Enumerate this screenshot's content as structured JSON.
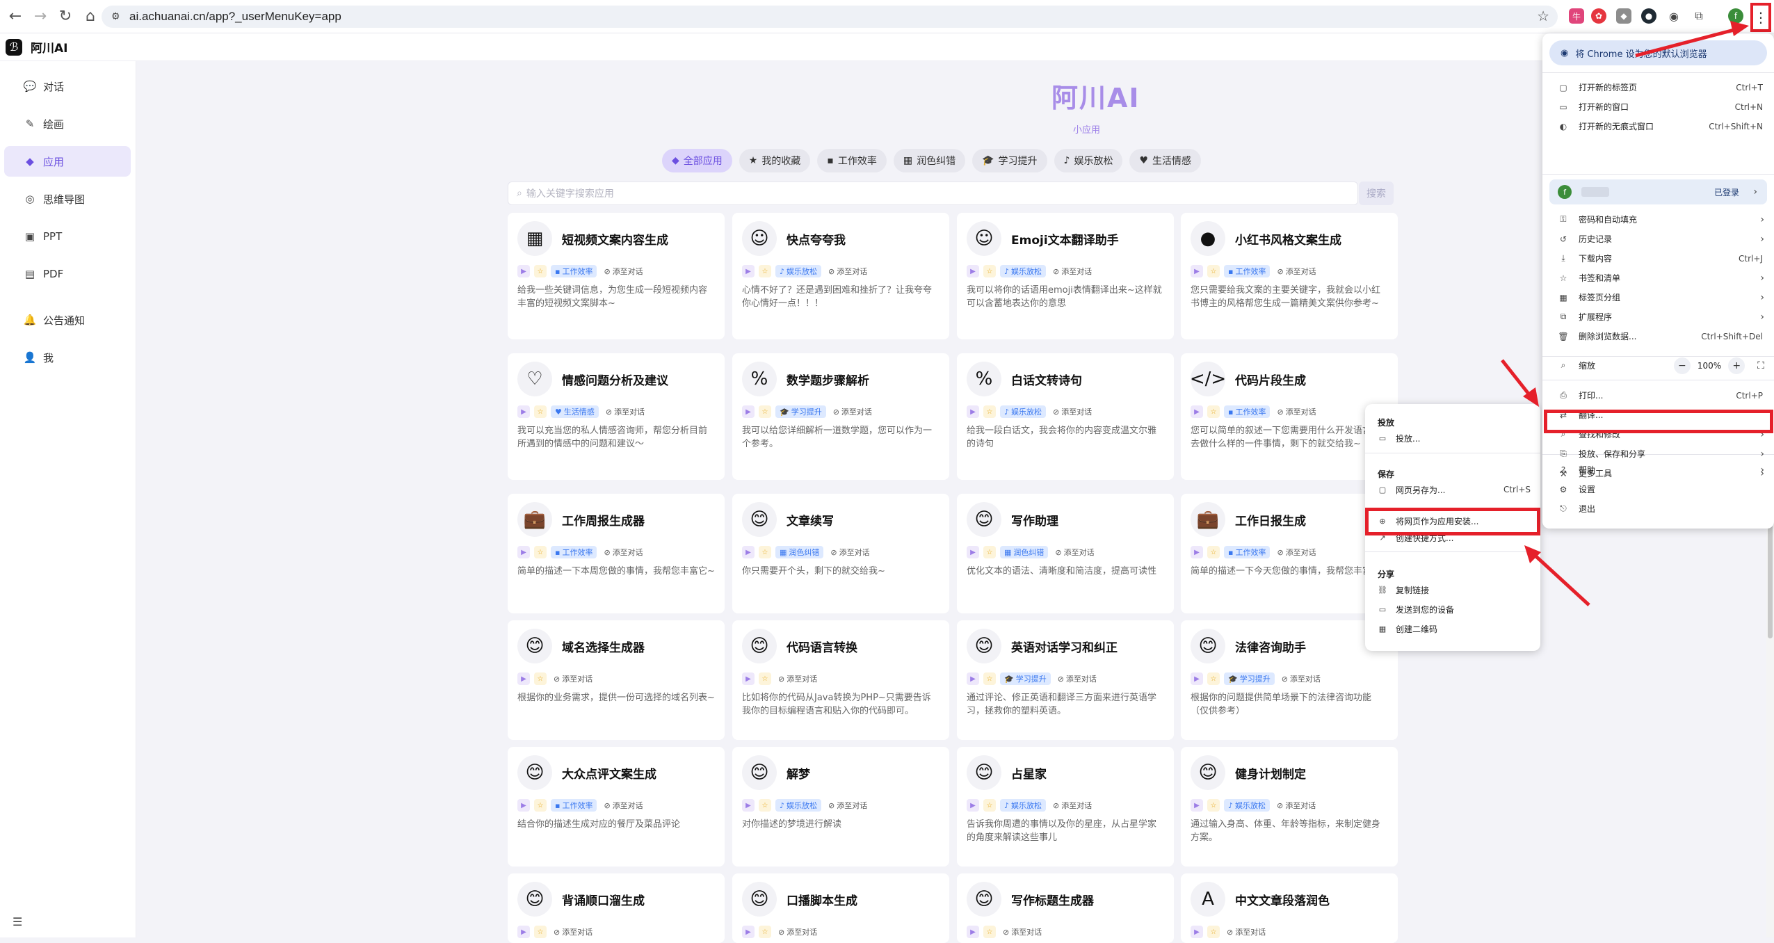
{
  "browser": {
    "url": "ai.achuanai.cn/app?_userMenuKey=app",
    "nav": {
      "back": "←",
      "forward": "→",
      "reload": "↻",
      "home": "⌂"
    },
    "extensions": [
      {
        "icon": "ext-pink-icon",
        "color": "#e0457b"
      },
      {
        "icon": "ext-red-icon",
        "color": "#e5353f"
      },
      {
        "icon": "ext-gray-icon",
        "color": "#8d8d8d"
      },
      {
        "icon": "ext-dark-icon",
        "color": "#1f2a33"
      },
      {
        "icon": "puzzle-icon",
        "color": "#ffffff"
      }
    ],
    "profile_initial": "f",
    "kebab": "⋮"
  },
  "app": {
    "name": "阿川AI",
    "logo_glyph": "ℬ",
    "sidebar": [
      {
        "icon": "💬",
        "label": "对话"
      },
      {
        "icon": "✎",
        "label": "绘画"
      },
      {
        "icon": "◆",
        "label": "应用",
        "active": true
      },
      {
        "icon": "◎",
        "label": "思维导图"
      },
      {
        "icon": "▣",
        "label": "PPT"
      },
      {
        "icon": "▤",
        "label": "PDF"
      },
      {
        "icon": "🔔",
        "label": "公告通知"
      },
      {
        "icon": "👤",
        "label": "我"
      }
    ],
    "collapse_icon": "☰"
  },
  "main": {
    "title": "阿川AI",
    "subtitle": "小应用",
    "categories": [
      {
        "icon": "◆",
        "label": "全部应用",
        "active": true
      },
      {
        "icon": "★",
        "label": "我的收藏"
      },
      {
        "icon": "▪",
        "label": "工作效率"
      },
      {
        "icon": "▦",
        "label": "润色纠错"
      },
      {
        "icon": "🎓",
        "label": "学习提升"
      },
      {
        "icon": "♪",
        "label": "娱乐放松"
      },
      {
        "icon": "♥",
        "label": "生活情感"
      }
    ],
    "search_placeholder": "输入关键字搜索应用",
    "search_button": "搜索",
    "add_label": "添至对话",
    "cards": [
      {
        "icon": "▦",
        "title": "短视频文案内容生成",
        "tag": "工作效率",
        "desc": "给我一些关键词信息，为您生成一段短视频内容丰富的短视频文案脚本~"
      },
      {
        "icon": "☺",
        "title": "快点夸夸我",
        "tag": "娱乐放松",
        "desc": "心情不好了？还是遇到困难和挫折了？让我夸夸你心情好一点！！！"
      },
      {
        "icon": "☺",
        "title": "Emoji文本翻译助手",
        "tag": "娱乐放松",
        "desc": "我可以将你的话语用emoji表情翻译出来~这样就可以含蓄地表达你的意思"
      },
      {
        "icon": "●",
        "title": "小红书风格文案生成",
        "tag": "工作效率",
        "desc": "您只需要给我文案的主要关键字，我就会以小红书博主的风格帮您生成一篇精美文案供你参考~"
      },
      {
        "icon": "♡",
        "title": "情感问题分析及建议",
        "tag": "生活情感",
        "desc": "我可以充当您的私人情感咨询师，帮您分析目前所遇到的情感中的问题和建议～"
      },
      {
        "icon": "%",
        "title": "数学题步骤解析",
        "tag": "学习提升",
        "desc": "我可以给您详细解析一道数学题，您可以作为一个参考。"
      },
      {
        "icon": "%",
        "title": "白话文转诗句",
        "tag": "娱乐放松",
        "desc": "给我一段白话文，我会将你的内容变成温文尔雅的诗句"
      },
      {
        "icon": "</>",
        "title": "代码片段生成",
        "tag": "工作效率",
        "desc": "您可以简单的叙述一下您需要用什么开发语言，去做什么样的一件事情，剩下的就交给我~"
      },
      {
        "icon": "💼",
        "title": "工作周报生成器",
        "tag": "工作效率",
        "desc": "简单的描述一下本周您做的事情，我帮您丰富它~"
      },
      {
        "icon": "😊",
        "title": "文章续写",
        "tag": "润色纠错",
        "desc": "你只需要开个头，剩下的就交给我~"
      },
      {
        "icon": "😊",
        "title": "写作助理",
        "tag": "润色纠错",
        "desc": "优化文本的语法、清晰度和简洁度，提高可读性"
      },
      {
        "icon": "💼",
        "title": "工作日报生成",
        "tag": "工作效率",
        "desc": "简单的描述一下今天您做的事情，我帮您丰富它~"
      },
      {
        "icon": "😊",
        "title": "域名选择生成器",
        "tag": "",
        "desc": "根据你的业务需求，提供一份可选择的域名列表~"
      },
      {
        "icon": "😊",
        "title": "代码语言转换",
        "tag": "",
        "desc": "比如将你的代码从Java转换为PHP~只需要告诉我你的目标编程语言和贴入你的代码即可。"
      },
      {
        "icon": "😊",
        "title": "英语对话学习和纠正",
        "tag": "学习提升",
        "desc": "通过评论、修正英语和翻译三方面来进行英语学习，拯救你的塑料英语。"
      },
      {
        "icon": "😊",
        "title": "法律咨询助手",
        "tag": "学习提升",
        "desc": "根据你的问题提供简单场景下的法律咨询功能（仅供参考）"
      },
      {
        "icon": "😊",
        "title": "大众点评文案生成",
        "tag": "工作效率",
        "desc": "结合你的描述生成对应的餐厅及菜品评论"
      },
      {
        "icon": "😊",
        "title": "解梦",
        "tag": "娱乐放松",
        "desc": "对你描述的梦境进行解读"
      },
      {
        "icon": "😊",
        "title": "占星家",
        "tag": "娱乐放松",
        "desc": "告诉我你周遭的事情以及你的星座，从占星学家的角度来解读这些事儿"
      },
      {
        "icon": "😊",
        "title": "健身计划制定",
        "tag": "娱乐放松",
        "desc": "通过输入身高、体重、年龄等指标，来制定健身方案。"
      },
      {
        "icon": "😊",
        "title": "背诵顺口溜生成",
        "tag": "",
        "desc": ""
      },
      {
        "icon": "😊",
        "title": "口播脚本生成",
        "tag": "",
        "desc": ""
      },
      {
        "icon": "😊",
        "title": "写作标题生成器",
        "tag": "",
        "desc": ""
      },
      {
        "icon": "A",
        "title": "中文文章段落润色",
        "tag": "",
        "desc": ""
      }
    ]
  },
  "chrome_menu": {
    "promo": "将 Chrome 设为您的默认浏览器",
    "items1": [
      {
        "icon": "▢",
        "label": "打开新的标签页",
        "shortcut": "Ctrl+T"
      },
      {
        "icon": "▭",
        "label": "打开新的窗口",
        "shortcut": "Ctrl+N"
      },
      {
        "icon": "◐",
        "label": "打开新的无痕式窗口",
        "shortcut": "Ctrl+Shift+N"
      }
    ],
    "profile_status": "已登录",
    "items2": [
      {
        "icon": "⚿",
        "label": "密码和自动填充",
        "arrow": "›"
      },
      {
        "icon": "↺",
        "label": "历史记录",
        "arrow": "›"
      },
      {
        "icon": "⤓",
        "label": "下载内容",
        "shortcut": "Ctrl+J"
      },
      {
        "icon": "☆",
        "label": "书签和清单",
        "arrow": "›"
      },
      {
        "icon": "▦",
        "label": "标签页分组",
        "arrow": "›"
      },
      {
        "icon": "⧉",
        "label": "扩展程序",
        "arrow": "›"
      },
      {
        "icon": "🗑",
        "label": "删除浏览数据...",
        "shortcut": "Ctrl+Shift+Del"
      }
    ],
    "zoom_label": "缩放",
    "zoom_value": "100%",
    "zoom_minus": "−",
    "zoom_plus": "+",
    "zoom_full": "⛶",
    "items3": [
      {
        "icon": "⎙",
        "label": "打印...",
        "shortcut": "Ctrl+P"
      },
      {
        "icon": "⇄",
        "label": "翻译..."
      },
      {
        "icon": "⌕",
        "label": "查找和修改",
        "arrow": "›"
      },
      {
        "icon": "⎘",
        "label": "投放、保存和分享",
        "arrow": "›"
      },
      {
        "icon": "⚒",
        "label": "更多工具",
        "arrow": "›"
      }
    ],
    "items4": [
      {
        "icon": "?",
        "label": "帮助",
        "arrow": "›"
      },
      {
        "icon": "⚙",
        "label": "设置"
      },
      {
        "icon": "⎋",
        "label": "退出"
      }
    ]
  },
  "submenu": {
    "cast_header": "投放",
    "cast": "投放...",
    "save_header": "保存",
    "save_as": "网页另存为...",
    "save_as_shortcut": "Ctrl+S",
    "install": "将网页作为应用安装...",
    "shortcut": "创建快捷方式...",
    "share_header": "分享",
    "copy_link": "复制链接",
    "send_device": "发送到您的设备",
    "qr": "创建二维码"
  },
  "highlight_color": "#e5202a"
}
